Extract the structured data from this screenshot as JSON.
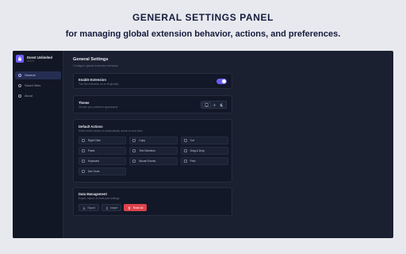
{
  "banner": {
    "headline": "GENERAL SETTINGS PANEL",
    "subline": "for managing global extension behavior, actions, and preferences."
  },
  "sidebar": {
    "app_name": "Unlimited",
    "app_name_prefix": "Dvent",
    "app_version": "v1.0.0",
    "items": [
      {
        "label": "General",
        "icon": "gear-icon",
        "active": true
      },
      {
        "label": "Saved Sites",
        "icon": "globe-icon",
        "active": false
      },
      {
        "label": "About",
        "icon": "info-icon",
        "active": false
      }
    ]
  },
  "main": {
    "title": "General Settings",
    "subtitle": "Configure global extension behavior"
  },
  "enable": {
    "title": "Enable Extension",
    "desc": "Turn the extension on or off globally",
    "on": true
  },
  "theme": {
    "title": "Theme",
    "desc": "Choose your preferred appearance",
    "options": [
      "monitor-icon",
      "sun-icon",
      "moon-icon"
    ],
    "selected": 0
  },
  "actions": {
    "title": "Default Actions",
    "desc": "Select which actions to automatically unlock on new sites",
    "items": [
      "Right Click",
      "Copy",
      "Cut",
      "Paste",
      "Text Selection",
      "Drag & Drop",
      "Keyboard",
      "Mouse Events",
      "Print",
      "Dev Tools"
    ]
  },
  "data_mgmt": {
    "title": "Data Management",
    "desc": "Export, import, or reset your settings",
    "export_label": "Export",
    "import_label": "Import",
    "reset_label": "Reset All"
  },
  "colors": {
    "accent": "#6b5cf6",
    "danger": "#e0424a",
    "panel_bg": "#1a2030",
    "card_bg": "#121827"
  }
}
